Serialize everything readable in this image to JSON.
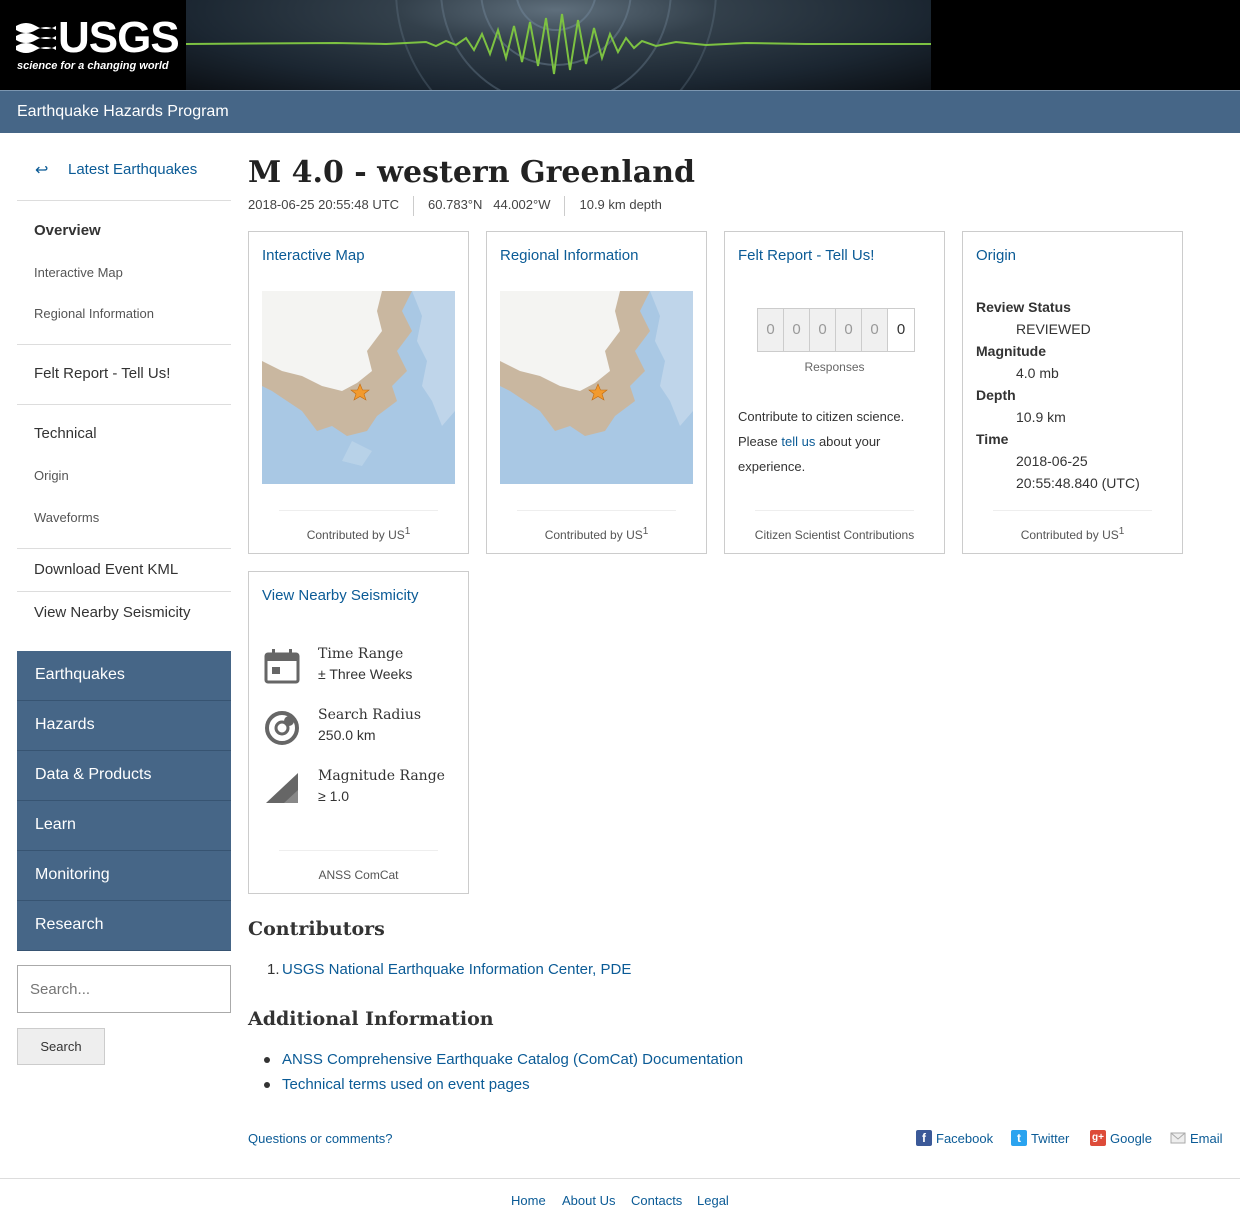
{
  "header": {
    "logo_text": "USGS",
    "logo_tagline": "science for a changing world",
    "program_title": "Earthquake Hazards Program"
  },
  "sidebar": {
    "back_arrow": "↩",
    "back_label": "Latest Earthquakes",
    "overview": "Overview",
    "interactive_map": "Interactive Map",
    "regional_information": "Regional Information",
    "felt_report": "Felt Report - Tell Us!",
    "technical": "Technical",
    "origin": "Origin",
    "waveforms": "Waveforms",
    "download_kml": "Download Event KML",
    "view_nearby": "View Nearby Seismicity",
    "sections": [
      "Earthquakes",
      "Hazards",
      "Data & Products",
      "Learn",
      "Monitoring",
      "Research"
    ],
    "search_placeholder": "Search...",
    "search_button": "Search"
  },
  "event": {
    "title": "M 4.0 - western Greenland",
    "time": "2018-06-25 20:55:48 UTC",
    "latitude": "60.783°N",
    "longitude": "44.002°W",
    "depth": "10.9 km depth"
  },
  "cards": {
    "interactive_map": {
      "title": "Interactive Map",
      "footer": "Contributed by US",
      "sup": "1"
    },
    "regional_information": {
      "title": "Regional Information",
      "footer": "Contributed by US",
      "sup": "1"
    },
    "felt_report": {
      "title": "Felt Report - Tell Us!",
      "digits": [
        "0",
        "0",
        "0",
        "0",
        "0",
        "0"
      ],
      "responses_label": "Responses",
      "text_1": "Contribute to citizen science.",
      "text_2a": "Please ",
      "text_link": "tell us",
      "text_2b": " about your",
      "text_3": "experience.",
      "footer": "Citizen Scientist Contributions"
    },
    "origin": {
      "title": "Origin",
      "review_status_label": "Review Status",
      "review_status": "REVIEWED",
      "magnitude_label": "Magnitude",
      "magnitude": "4.0 mb",
      "depth_label": "Depth",
      "depth": "10.9 km",
      "time_label": "Time",
      "time_date": "2018-06-25",
      "time_clock": "20:55:48.840 (UTC)",
      "footer": "Contributed by US",
      "sup": "1"
    },
    "nearby": {
      "title": "View Nearby Seismicity",
      "time_range_label": "Time Range",
      "time_range": "± Three Weeks",
      "search_radius_label": "Search Radius",
      "search_radius": "250.0 km",
      "magnitude_range_label": "Magnitude Range",
      "magnitude_range": "≥ 1.0",
      "footer": "ANSS ComCat"
    }
  },
  "contributors": {
    "heading": "Contributors",
    "items": [
      "USGS National Earthquake Information Center, PDE"
    ],
    "number": "1."
  },
  "additional": {
    "heading": "Additional Information",
    "items": [
      "ANSS Comprehensive Earthquake Catalog (ComCat) Documentation",
      "Technical terms used on event pages"
    ]
  },
  "page_footer": {
    "questions": "Questions or comments?",
    "share": [
      "Facebook",
      "Twitter",
      "Google",
      "Email"
    ],
    "links": [
      "Home",
      "About Us",
      "Contacts",
      "Legal"
    ]
  },
  "colors": {
    "nav_blue": "#466687",
    "link": "#0b5b96",
    "map_water": "#a9c8e4",
    "map_land": "#c9b7a0",
    "epicenter": "#f29a2e"
  }
}
